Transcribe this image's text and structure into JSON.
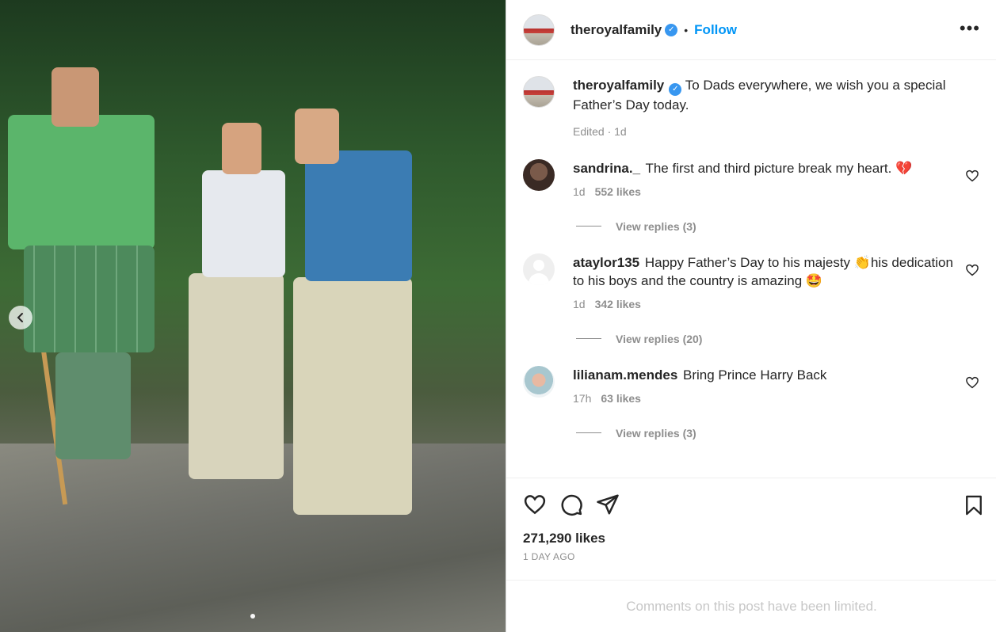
{
  "post": {
    "image_alt": "Father and two sons standing on rocks in a forest",
    "carousel_dots": 1
  },
  "header": {
    "username": "theroyalfamily",
    "verified": true,
    "separator": "•",
    "follow_label": "Follow",
    "more_label": "•••"
  },
  "caption": {
    "username": "theroyalfamily",
    "text": "To Dads everywhere, we wish you a special Father’s Day today.",
    "meta": "Edited · 1d"
  },
  "comments": [
    {
      "username": "sandrina._",
      "text": "The first and third picture break my heart. 💔",
      "age": "1d",
      "likes": "552 likes",
      "replies": "View replies (3)"
    },
    {
      "username": "ataylor135",
      "text": "Happy Father’s Day to his majesty 👏his dedication to his boys and the country is amazing 🤩",
      "age": "1d",
      "likes": "342 likes",
      "replies": "View replies (20)"
    },
    {
      "username": "lilianam.mendes",
      "text": "Bring Prince Harry Back",
      "age": "17h",
      "likes": "63 likes",
      "replies": "View replies (3)"
    }
  ],
  "actions": {
    "likes_total": "271,290 likes",
    "date": "1 DAY AGO",
    "limited_notice": "Comments on this post have been limited."
  },
  "colors": {
    "accent": "#0095f6",
    "verified": "#3897f0",
    "muted": "#8e8e8e"
  },
  "icons": [
    "chevron-left-icon",
    "verified-icon",
    "more-icon",
    "heart-icon",
    "comment-icon",
    "share-icon",
    "bookmark-icon"
  ]
}
